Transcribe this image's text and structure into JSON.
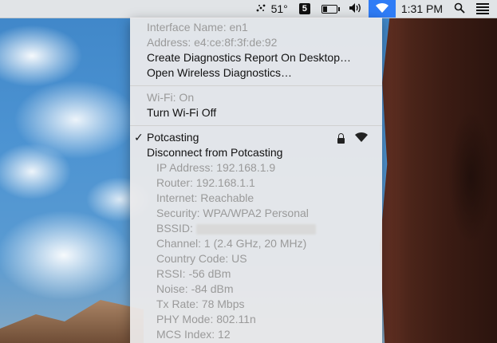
{
  "menubar": {
    "temperature": "51°",
    "calendar_badge": "5",
    "time": "1:31 PM"
  },
  "menu": {
    "interface_name": "Interface Name: en1",
    "address": "Address: e4:ce:8f:3f:de:92",
    "create_report": "Create Diagnostics Report On Desktop…",
    "open_diagnostics": "Open Wireless Diagnostics…",
    "wifi_status": "Wi-Fi: On",
    "turn_off": "Turn Wi-Fi Off",
    "network_name": "Potcasting",
    "checkmark": "✓",
    "disconnect": "Disconnect from Potcasting",
    "details": [
      "IP Address: 192.168.1.9",
      "Router: 192.168.1.1",
      "Internet: Reachable",
      "Security: WPA/WPA2 Personal",
      "BSSID:",
      "Channel: 1 (2.4 GHz, 20 MHz)",
      "Country Code: US",
      "RSSI: -56 dBm",
      "Noise: -84 dBm",
      "Tx Rate: 78 Mbps",
      "PHY Mode: 802.11n",
      "MCS Index: 12"
    ]
  },
  "icons": {
    "weather": "weather-icon",
    "calendar": "calendar-icon",
    "battery": "battery-icon",
    "volume": "volume-icon",
    "wifi": "wifi-icon",
    "search": "search-icon",
    "notifications": "notification-center-icon",
    "lock": "lock-icon",
    "signal": "wifi-signal-icon"
  }
}
